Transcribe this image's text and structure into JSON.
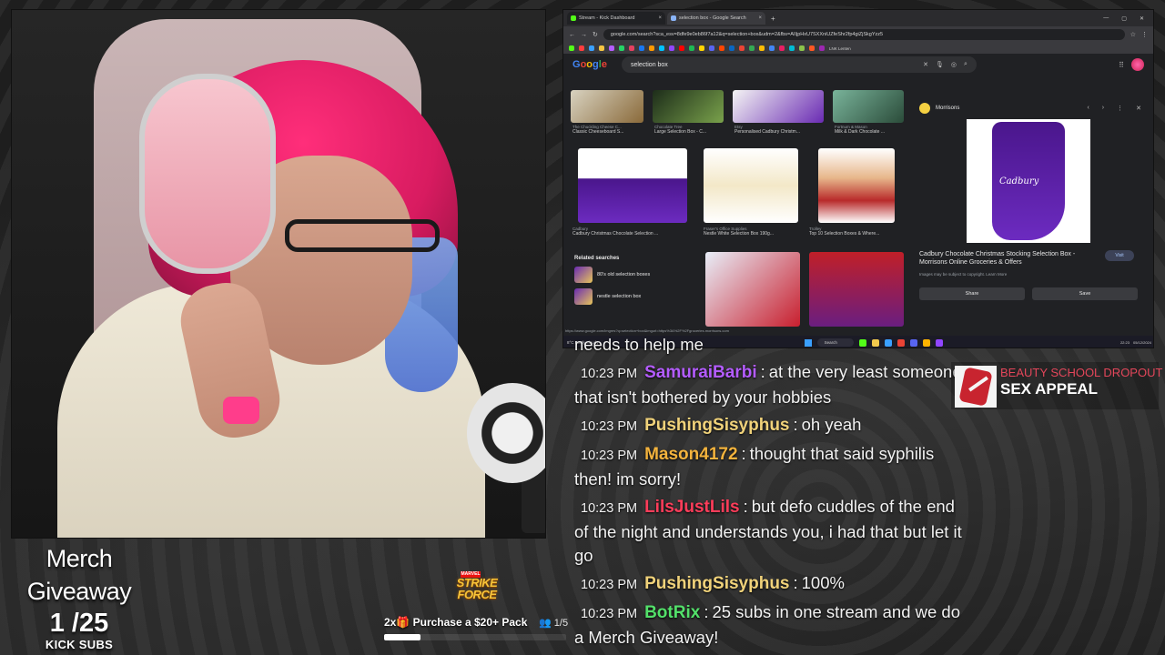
{
  "browser": {
    "tabs": [
      {
        "label": "Stream - Kick Dashboard",
        "color": "#53fc18"
      },
      {
        "label": "selection box - Google Search",
        "color": "#8ab4f8"
      }
    ],
    "url": "google.com/search?sca_esv=8dfe9e0eb86f7a12&q=selection+box&udm=2&fbs=AIIjpHxU7SXXniUZfeShr2fp4giZjSkgYzz5",
    "bookmark_label": "LNK Lenten",
    "google_logo": "Google",
    "search_query": "selection box",
    "results": [
      {
        "source": "The Chuckling Cheese C...",
        "title": "Classic Cheeseboard S..."
      },
      {
        "source": "Chocolate Tree",
        "title": "Large Selection Box - C..."
      },
      {
        "source": "Etsy",
        "title": "Personalised Cadbury Christm..."
      },
      {
        "source": "Fortnum & Mason",
        "title": "Milk & Dark Chocolate ..."
      },
      {
        "source": "Cadbury",
        "title": "Cadbury Christmas Chocolate Selection ..."
      },
      {
        "source": "Fraser's Office Supplies",
        "title": "Nestle White Selection Box 190g..."
      },
      {
        "source": "Trolley",
        "title": "Top 10 Selection Boxes & Where..."
      }
    ],
    "related_title": "Related searches",
    "related": [
      "80's old selection boxes",
      "nestle selection box"
    ],
    "panel": {
      "source": "Morrisons",
      "product_brand": "Cadbury",
      "title": "Cadbury Chocolate Christmas Stocking Selection Box - Morrisons Online Groceries & Offers",
      "visit": "Visit",
      "note": "Images may be subject to copyright. Learn More",
      "share": "Share",
      "save": "Save"
    },
    "status_url": "https://www.google.com/imgres?q=selection+box&imgurl=https%3A%2F%2Fgroceries.morrisons.com",
    "taskbar": {
      "search": "Search",
      "time": "22:23",
      "date": "05/12/2024",
      "weather": "8°C Partly cloudy"
    }
  },
  "chat": [
    {
      "time": "",
      "user": "",
      "text": "needs to help me",
      "color": "#f2f2f2"
    },
    {
      "time": "10:23 PM",
      "user": "SamuraiBarbi",
      "text": "at the very least someone that isn't bothered by your hobbies",
      "color": "#b45cff"
    },
    {
      "time": "10:23 PM",
      "user": "PushingSisyphus",
      "text": "oh yeah",
      "color": "#f0d27a"
    },
    {
      "time": "10:23 PM",
      "user": "Mason4172",
      "text": "thought that said syphilis then! im sorry!",
      "color": "#f3b33d"
    },
    {
      "time": "10:23 PM",
      "user": "LilsJustLils",
      "text": "but defo cuddles of the end of the night and understands you, i had that but let it go",
      "color": "#ff3d5a"
    },
    {
      "time": "10:23 PM",
      "user": "PushingSisyphus",
      "text": "100%",
      "color": "#f0d27a"
    },
    {
      "time": "10:23 PM",
      "user": "BotRix",
      "text": "25 subs in one stream and we do a Merch Giveaway!",
      "color": "#53e06a"
    }
  ],
  "now_playing": {
    "artist": "BEAUTY SCHOOL DROPOUT",
    "title": "SEX APPEAL"
  },
  "merch": {
    "line1": "Merch",
    "line2": "Giveaway",
    "count": "1 /25",
    "sub": "KICK SUBS"
  },
  "sponsor": {
    "marvel": "MARVEL",
    "logo": "STRIKE FORCE",
    "text": "2x🎁 Purchase a $20+ Pack",
    "count": "1/5",
    "progress": 0.2
  }
}
